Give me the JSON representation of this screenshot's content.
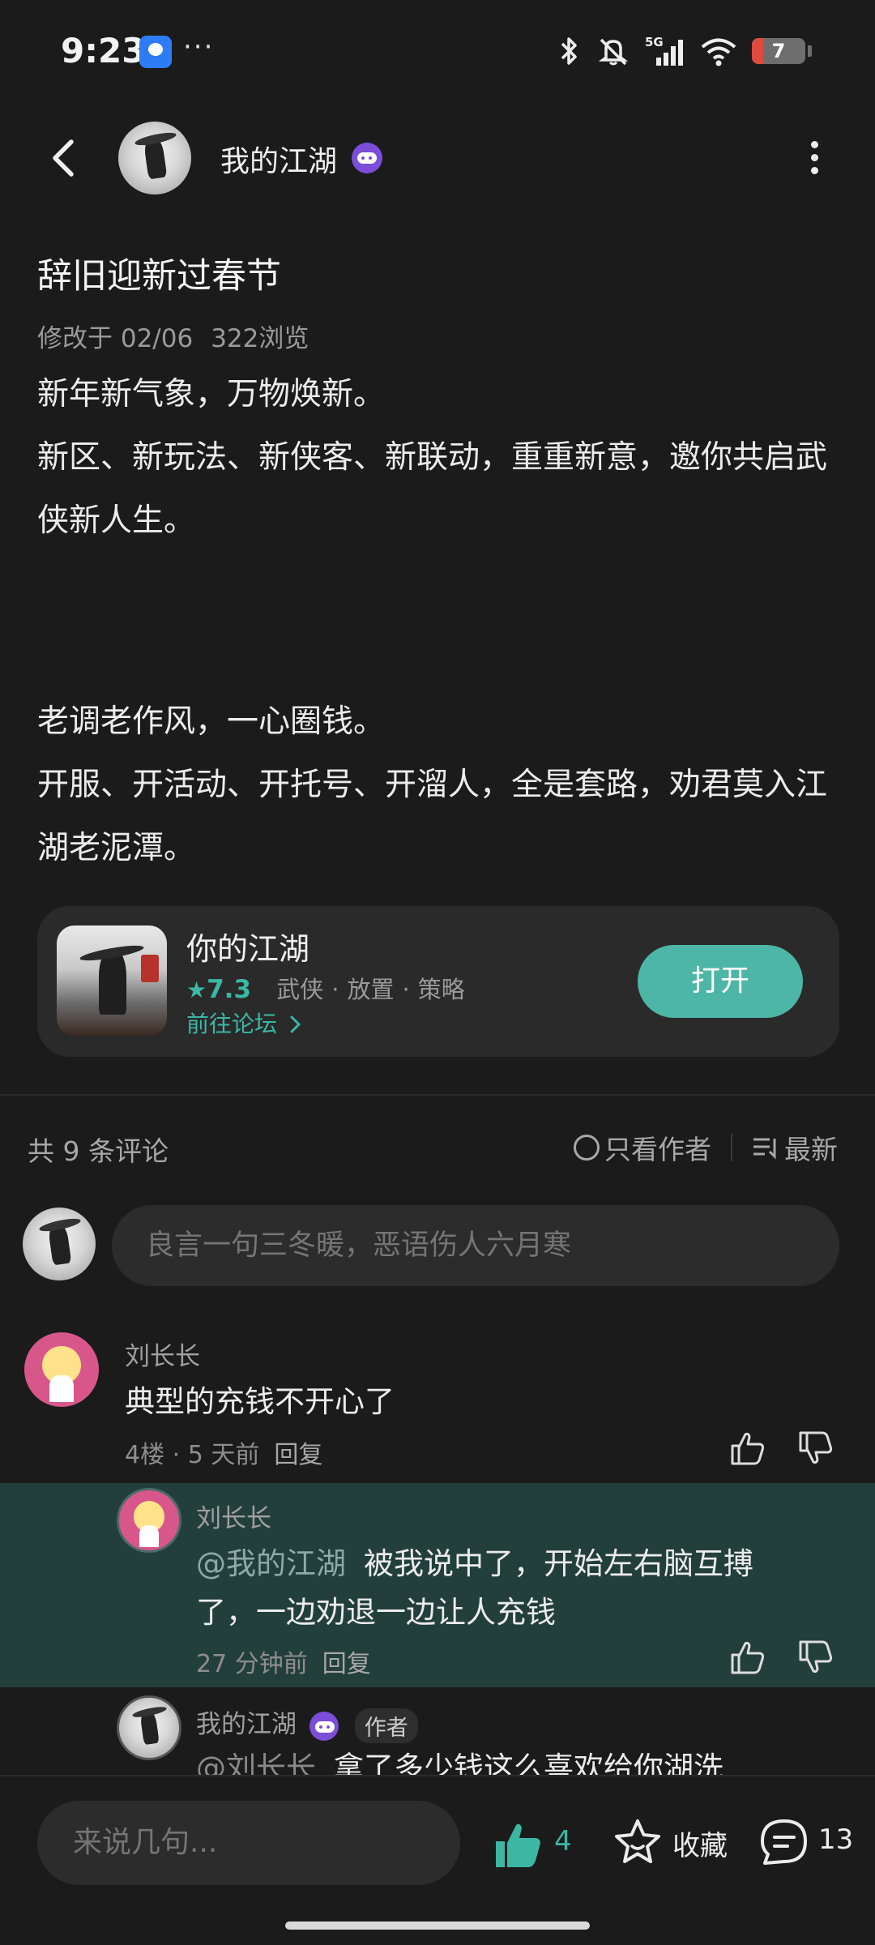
{
  "status_bar": {
    "time": "9:23",
    "more": "···",
    "network": "5G",
    "battery": "7"
  },
  "header": {
    "author_name": "我的江湖"
  },
  "post": {
    "title": "辞旧迎新过春节",
    "modified": "修改于 02/06",
    "views": "322浏览",
    "paragraphs": [
      "新年新气象，万物焕新。",
      "新区、新玩法、新侠客、新联动，重重新意，邀你共启武侠新人生。",
      "老调老作风，一心圈钱。",
      "开服、开活动、开托号、开溜人，全是套路，劝君莫入江湖老泥潭。"
    ]
  },
  "app_card": {
    "name": "你的江湖",
    "rating": "7.3",
    "tags": [
      "武侠",
      "放置",
      "策略"
    ],
    "forum_link": "前往论坛",
    "open_label": "打开",
    "accent": "#4db6a6"
  },
  "comments_header": {
    "count_label": "共 9 条评论",
    "author_only": "只看作者",
    "sort": "最新"
  },
  "comment_input": {
    "placeholder": "良言一句三冬暖，恶语伤人六月寒"
  },
  "comments": [
    {
      "user": "刘长长",
      "text": "典型的充钱不开心了",
      "floor": "4楼",
      "time": "5 天前",
      "reply_label": "回复"
    }
  ],
  "replies": [
    {
      "user": "刘长长",
      "mention": "@我的江湖",
      "text_line1": "被我说中了，开始左右脑互搏",
      "text_line2": "了，一边劝退一边让人充钱",
      "time": "27 分钟前",
      "reply_label": "回复"
    },
    {
      "user": "我的江湖",
      "tag": "作者",
      "mention": "@刘长长",
      "text": "拿了多少钱这么喜欢给你湖洗"
    }
  ],
  "bottom_bar": {
    "input_placeholder": "来说几句...",
    "like_count": "4",
    "favorite_label": "收藏",
    "comment_count": "13"
  }
}
